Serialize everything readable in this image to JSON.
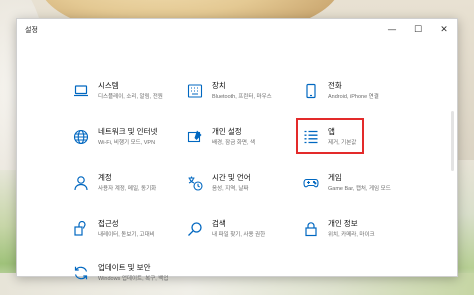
{
  "window": {
    "title": "설정"
  },
  "controls": {
    "minimize": "—",
    "maximize": "☐",
    "close": "✕"
  },
  "tiles": [
    {
      "title": "시스템",
      "desc": "디스플레이, 소리, 알림, 전원",
      "icon": "laptop-icon"
    },
    {
      "title": "장치",
      "desc": "Bluetooth, 프린터, 마우스",
      "icon": "keyboard-icon"
    },
    {
      "title": "전화",
      "desc": "Android, iPhone 연결",
      "icon": "phone-icon"
    },
    {
      "title": "네트워크 및 인터넷",
      "desc": "Wi-Fi, 비행기 모드, VPN",
      "icon": "globe-icon"
    },
    {
      "title": "개인 설정",
      "desc": "배경, 잠금 화면, 색",
      "icon": "personalization-icon"
    },
    {
      "title": "앱",
      "desc": "제거, 기본값",
      "icon": "apps-list-icon"
    },
    {
      "title": "계정",
      "desc": "사용자 계정, 메일, 동기화",
      "icon": "person-icon"
    },
    {
      "title": "시간 및 언어",
      "desc": "음성, 지역, 날짜",
      "icon": "time-language-icon"
    },
    {
      "title": "게임",
      "desc": "Game Bar, 캡처, 게임 모드",
      "icon": "gamepad-icon"
    },
    {
      "title": "접근성",
      "desc": "내레이터, 돋보기, 고대비",
      "icon": "accessibility-icon"
    },
    {
      "title": "검색",
      "desc": "내 파일 찾기, 사용 권한",
      "icon": "search-icon"
    },
    {
      "title": "개인 정보",
      "desc": "위치, 카메라, 마이크",
      "icon": "lock-icon"
    },
    {
      "title": "업데이트 및 보안",
      "desc": "Windows 업데이트, 복구, 백업",
      "icon": "update-icon"
    }
  ],
  "accent_color": "#0067c0",
  "highlight_color": "#e32a2a"
}
